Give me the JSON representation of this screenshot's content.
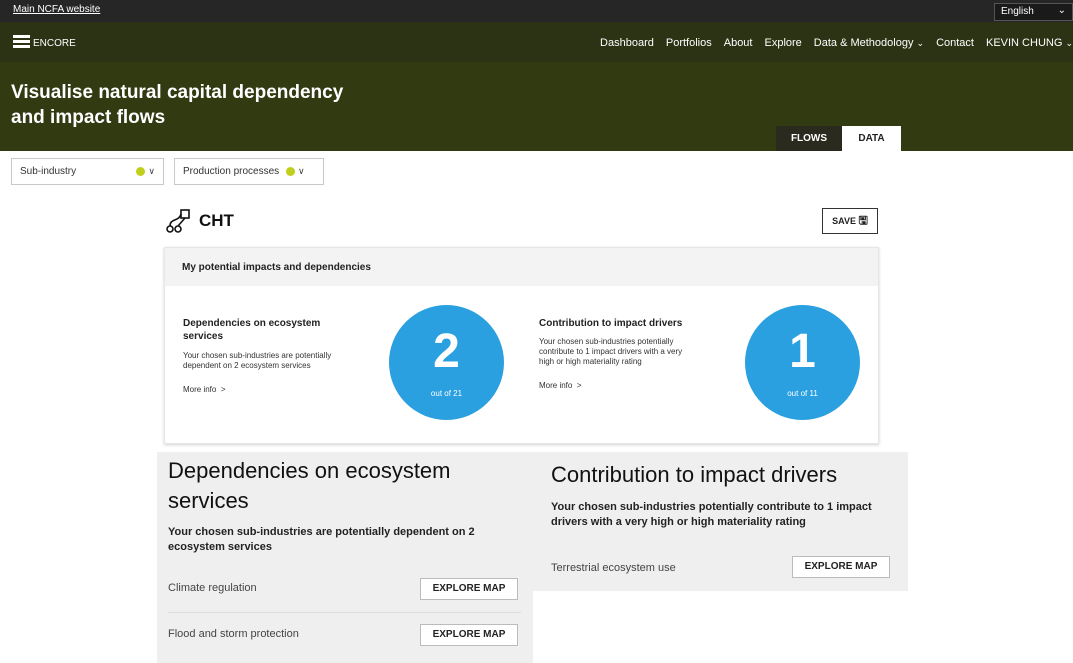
{
  "topbar": {
    "main_link": "Main NCFA website",
    "language": "English"
  },
  "navbar": {
    "brand": "ENCORE",
    "items": [
      "Dashboard",
      "Portfolios",
      "About",
      "Explore",
      "Data & Methodology",
      "Contact",
      "KEVIN CHUNG"
    ]
  },
  "hero": {
    "title_line1": "Visualise natural capital dependency",
    "title_line2": "and impact flows"
  },
  "tabs": {
    "flows": "FLOWS",
    "data": "DATA"
  },
  "filters": {
    "sub_industry": "Sub-industry",
    "production_processes": "Production processes"
  },
  "portfolio": {
    "name": "CHT",
    "save_label": "SAVE"
  },
  "summary": {
    "heading": "My potential impacts and dependencies",
    "dependencies": {
      "title_line1": "Dependencies on ecosystem",
      "title_line2": "services",
      "desc_line1": "Your chosen sub-industries are potentially",
      "desc_line2": "dependent on 2 ecosystem services",
      "more": "More info",
      "count": "2",
      "out_of": "out of 21"
    },
    "impacts": {
      "title": "Contribution to impact drivers",
      "desc_line1": "Your chosen sub-industries potentially",
      "desc_line2": "contribute to 1 impact drivers with a very",
      "desc_line3": "high or high materiality rating",
      "more": "More info",
      "count": "1",
      "out_of": "out of 11"
    }
  },
  "dependencies_panel": {
    "title_line1": "Dependencies on ecosystem",
    "title_line2": "services",
    "sub_line1": "Your chosen sub-industries are potentially dependent on 2",
    "sub_line2": "ecosystem services",
    "rows": [
      {
        "label": "Climate regulation",
        "button": "EXPLORE MAP"
      },
      {
        "label": "Flood and storm protection",
        "button": "EXPLORE MAP"
      }
    ]
  },
  "impacts_panel": {
    "title": "Contribution to impact drivers",
    "sub_line1": "Your chosen sub-industries potentially contribute to 1 impact",
    "sub_line2": "drivers with a very high or high materiality rating",
    "rows": [
      {
        "label": "Terrestrial ecosystem use",
        "button": "EXPLORE MAP"
      }
    ]
  },
  "colors": {
    "nav_bg": "#2c3314",
    "hero_bg": "#323a12",
    "accent_circle": "#2ba0e0",
    "dot": "#c2cf1a"
  }
}
